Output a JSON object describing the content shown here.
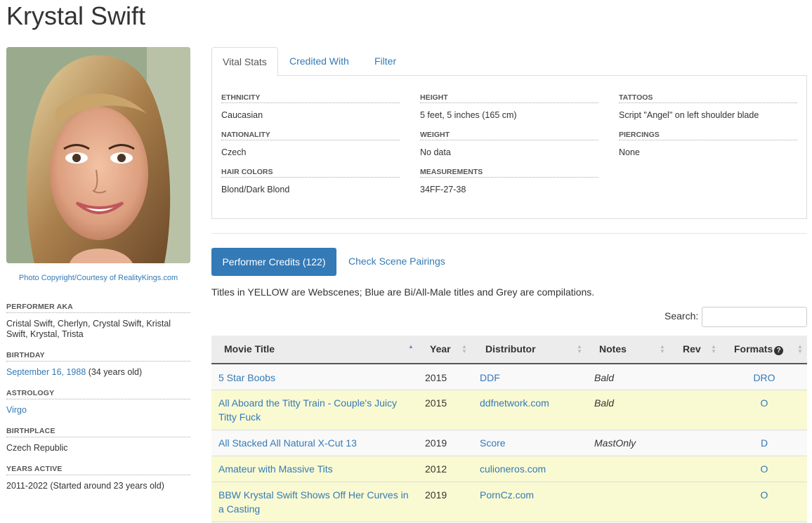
{
  "performer": {
    "name": "Krystal Swift",
    "photo_credit": "Photo Copyright/Courtesy of RealityKings.com"
  },
  "sidebar": {
    "aka_label": "PERFORMER AKA",
    "aka_value": "Cristal Swift, Cherlyn, Crystal Swift, Kristal Swift, Krystal, Trista",
    "birthday_label": "BIRTHDAY",
    "birthday_link": "September 16, 1988",
    "birthday_age": " (34 years old)",
    "astrology_label": "ASTROLOGY",
    "astrology_value": "Virgo",
    "birthplace_label": "BIRTHPLACE",
    "birthplace_value": "Czech Republic",
    "years_active_label": "YEARS ACTIVE",
    "years_active_value": "2011-2022 (Started around 23 years old)"
  },
  "tabs": [
    "Vital Stats",
    "Credited With",
    "Filter"
  ],
  "vitals": {
    "ethnicity_label": "ETHNICITY",
    "ethnicity": "Caucasian",
    "nationality_label": "NATIONALITY",
    "nationality": "Czech",
    "hair_label": "HAIR COLORS",
    "hair": "Blond/Dark Blond",
    "height_label": "HEIGHT",
    "height": "5 feet, 5 inches (165 cm)",
    "weight_label": "WEIGHT",
    "weight": "No data",
    "measurements_label": "MEASUREMENTS",
    "measurements": "34FF-27-38",
    "tattoos_label": "TATTOOS",
    "tattoos": "Script \"Angel\" on left shoulder blade",
    "piercings_label": "PIERCINGS",
    "piercings": "None"
  },
  "credits": {
    "button_label": "Performer Credits (122)",
    "pairings_link": "Check Scene Pairings",
    "legend": "Titles in YELLOW are Webscenes; Blue are Bi/All-Male titles and Grey are compilations.",
    "search_label": "Search:",
    "search_value": ""
  },
  "table": {
    "headers": [
      "Movie Title",
      "Year",
      "Distributor",
      "Notes",
      "Rev",
      "Formats"
    ],
    "formats_help_icon": "question-circle-icon",
    "rows": [
      {
        "title": "5 Star Boobs",
        "year": "2015",
        "distributor": "DDF",
        "notes": "Bald",
        "rev": "",
        "formats": "DRO",
        "kind": "white"
      },
      {
        "title": "All Aboard the Titty Train - Couple's Juicy Titty Fuck",
        "year": "2015",
        "distributor": "ddfnetwork.com",
        "notes": "Bald",
        "rev": "",
        "formats": "O",
        "kind": "yellow"
      },
      {
        "title": "All Stacked All Natural X-Cut 13",
        "year": "2019",
        "distributor": "Score",
        "notes": "MastOnly",
        "rev": "",
        "formats": "D",
        "kind": "white"
      },
      {
        "title": "Amateur with Massive Tits",
        "year": "2012",
        "distributor": "culioneros.com",
        "notes": "",
        "rev": "",
        "formats": "O",
        "kind": "yellow"
      },
      {
        "title": "BBW Krystal Swift Shows Off Her Curves in a Casting",
        "year": "2019",
        "distributor": "PornCz.com",
        "notes": "",
        "rev": "",
        "formats": "O",
        "kind": "yellow"
      }
    ]
  },
  "colors": {
    "link": "#337ab7",
    "webscene_row": "#fafad2",
    "button": "#337ab7"
  }
}
